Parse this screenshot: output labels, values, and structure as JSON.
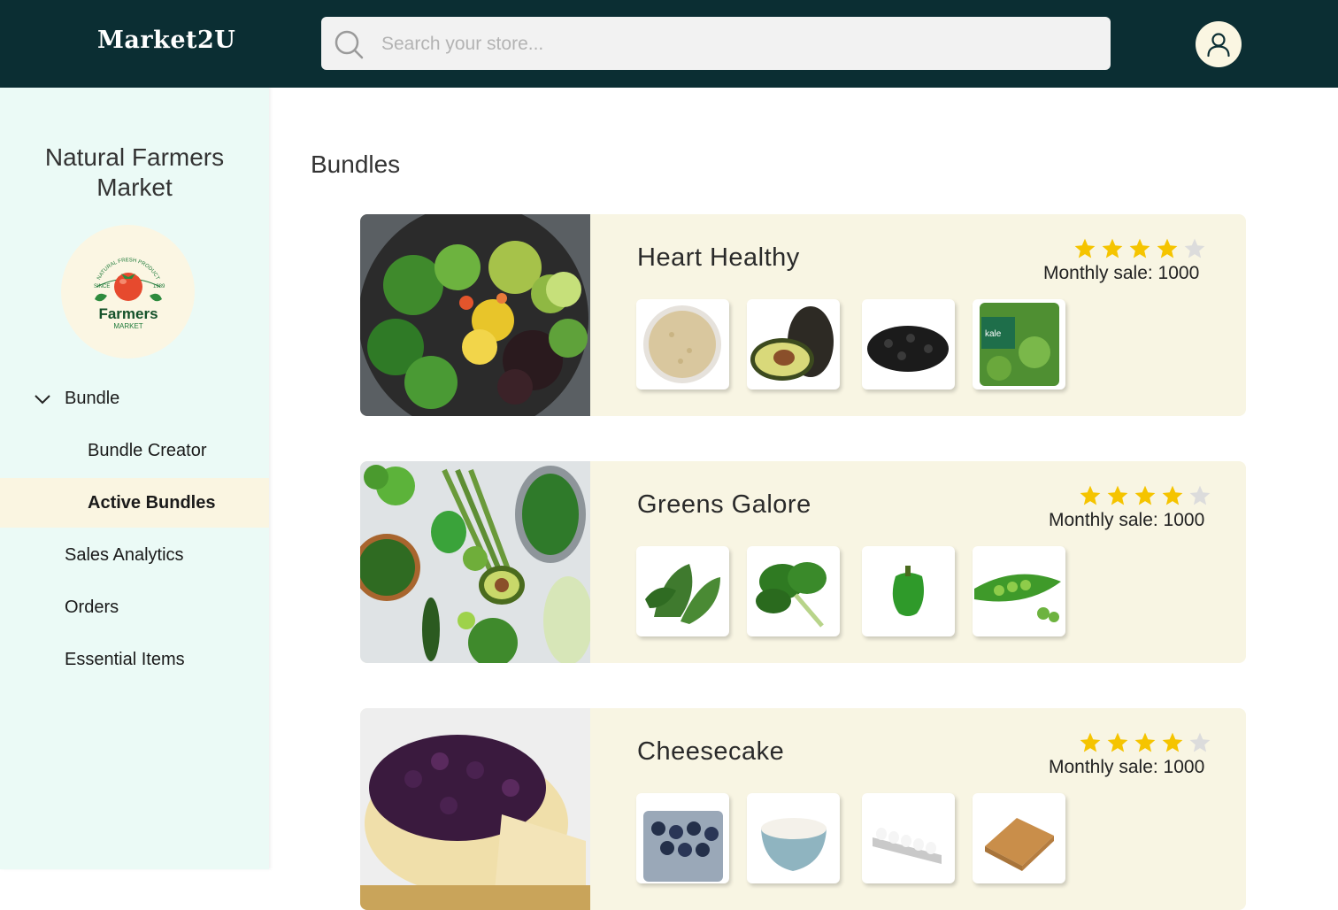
{
  "header": {
    "brand": "Market2U",
    "search_placeholder": "Search your store..."
  },
  "sidebar": {
    "store_name_line1": "Natural Farmers",
    "store_name_line2": "Market",
    "logo": {
      "top_text": "NATURAL FRESH PRODUCT",
      "since": "SINCE",
      "year": "1989",
      "name": "Farmers",
      "sub": "MARKET"
    },
    "nav": {
      "bundle": "Bundle",
      "bundle_creator": "Bundle Creator",
      "active_bundles": "Active Bundles",
      "sales_analytics": "Sales Analytics",
      "orders": "Orders",
      "essential_items": "Essential Items"
    }
  },
  "main": {
    "title": "Bundles",
    "bundles": [
      {
        "name": "Heart Healthy",
        "rating": 4,
        "sales": "Monthly sale: 1000",
        "items": [
          "quinoa",
          "avocado",
          "black-beans",
          "kale"
        ]
      },
      {
        "name": "Greens Galore",
        "rating": 4,
        "sales": "Monthly sale: 1000",
        "items": [
          "arugula",
          "spinach",
          "green-pepper",
          "peas"
        ]
      },
      {
        "name": "Cheesecake",
        "rating": 4,
        "sales": "Monthly sale: 1000",
        "items": [
          "blueberries",
          "cream-cheese",
          "eggs",
          "graham-crackers"
        ]
      }
    ]
  },
  "colors": {
    "header_bg": "#0b2e33",
    "sidebar_bg": "#ebfaf6",
    "card_bg": "#f8f5e3",
    "active_nav_bg": "#faf5e1",
    "star": "#f5c400",
    "star_empty": "#dcdcdc"
  },
  "icons": {
    "search": "search-icon",
    "user": "user-icon",
    "chevron": "chevron-down-icon",
    "star": "star-icon"
  }
}
